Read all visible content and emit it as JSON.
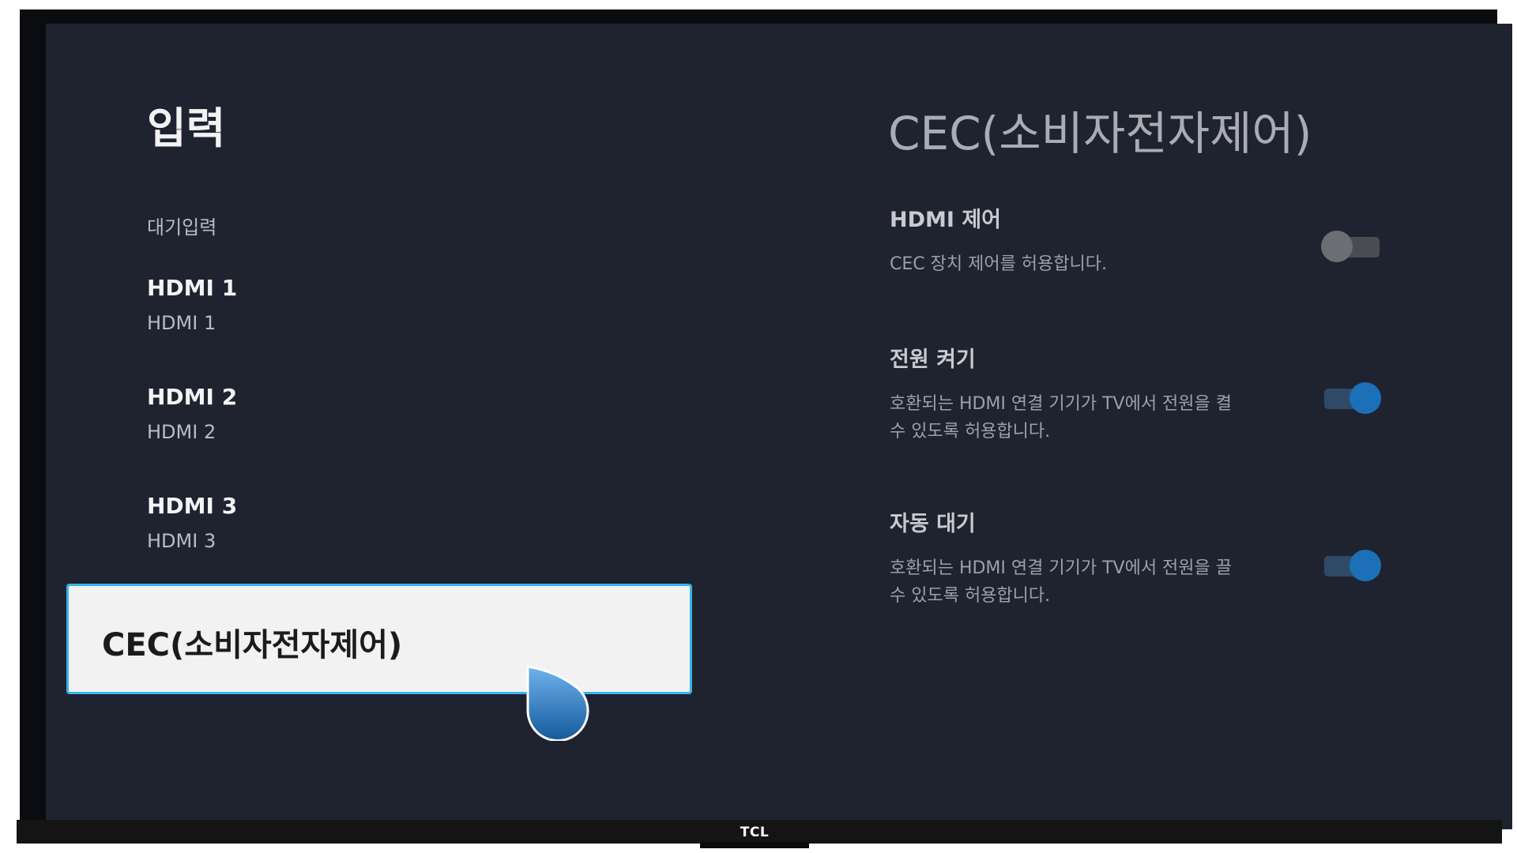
{
  "brand": "TCL",
  "left_panel": {
    "title": "입력",
    "standby_label": "대기입력",
    "inputs": [
      {
        "name": "HDMI 1",
        "sub": "HDMI 1"
      },
      {
        "name": "HDMI 2",
        "sub": "HDMI 2"
      },
      {
        "name": "HDMI 3",
        "sub": "HDMI 3"
      }
    ],
    "selected_item": "CEC(소비자전자제어)"
  },
  "right_panel": {
    "title": "CEC(소비자전자제어)",
    "settings": [
      {
        "title": "HDMI 제어",
        "desc": "CEC 장치 제어를 허용합니다.",
        "enabled": false
      },
      {
        "title": "전원 켜기",
        "desc": "호환되는 HDMI 연결 기기가 TV에서 전원을 켤 수 있도록 허용합니다.",
        "enabled": true
      },
      {
        "title": "자동 대기",
        "desc": "호환되는 HDMI 연결 기기가 TV에서 전원을 끌 수 있도록 허용합니다.",
        "enabled": true
      }
    ]
  },
  "colors": {
    "screen_bg": "#1f2330",
    "selection_border": "#34b4ea",
    "toggle_on": "#1b70b8",
    "toggle_off": "#6c6e75"
  },
  "icons": {
    "cursor": "pointer-cursor-icon"
  }
}
